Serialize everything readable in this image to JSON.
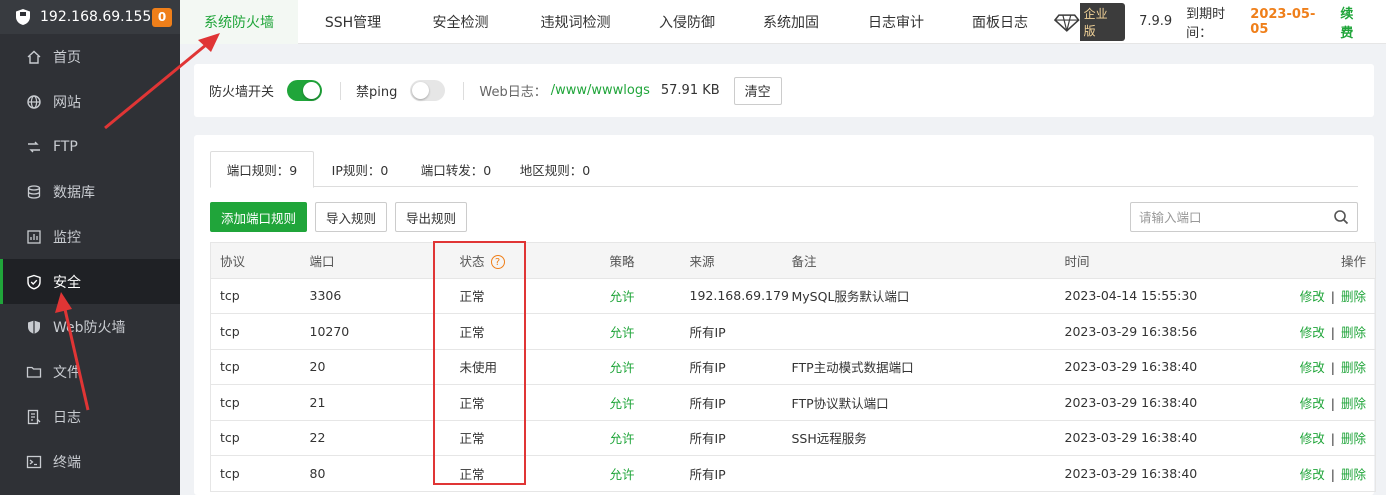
{
  "sidebar": {
    "ip": "192.168.69.155",
    "badge": "0",
    "items": [
      {
        "label": "首页",
        "icon": "home-icon"
      },
      {
        "label": "网站",
        "icon": "globe-icon"
      },
      {
        "label": "FTP",
        "icon": "ftp-icon"
      },
      {
        "label": "数据库",
        "icon": "database-icon"
      },
      {
        "label": "监控",
        "icon": "monitor-icon"
      },
      {
        "label": "安全",
        "icon": "shield-check-icon"
      },
      {
        "label": "Web防火墙",
        "icon": "shield-icon"
      },
      {
        "label": "文件",
        "icon": "folder-icon"
      },
      {
        "label": "日志",
        "icon": "log-icon"
      },
      {
        "label": "终端",
        "icon": "terminal-icon"
      }
    ],
    "active_index": 5
  },
  "topbar": {
    "tabs": [
      "系统防火墙",
      "SSH管理",
      "安全检测",
      "违规词检测",
      "入侵防御",
      "系统加固",
      "日志审计",
      "面板日志"
    ],
    "active_index": 0,
    "edition": "企业版",
    "version": "7.9.9",
    "expire_label": "到期时间：",
    "expire_date": "2023-05-05",
    "renew": "续费"
  },
  "firewall": {
    "switch_label": "防火墙开关",
    "switch_on": true,
    "ping_label": "禁ping",
    "ping_on": false,
    "weblog_label": "Web日志：",
    "weblog_path": "/www/wwwlogs",
    "weblog_size": "57.91 KB",
    "clear_label": "清空"
  },
  "subtabs": [
    "端口规则：9",
    "IP规则：0",
    "端口转发：0",
    "地区规则：0"
  ],
  "toolbar": {
    "add_label": "添加端口规则",
    "import_label": "导入规则",
    "export_label": "导出规则",
    "search_placeholder": "请输入端口"
  },
  "table": {
    "headers": [
      "协议",
      "端口",
      "状态",
      "策略",
      "来源",
      "备注",
      "时间",
      "操作"
    ],
    "rows": [
      {
        "protocol": "tcp",
        "port": "3306",
        "status": "正常",
        "policy": "允许",
        "source": "192.168.69.179",
        "remark": "MySQL服务默认端口",
        "time": "2023-04-14 15:55:30"
      },
      {
        "protocol": "tcp",
        "port": "10270",
        "status": "正常",
        "policy": "允许",
        "source": "所有IP",
        "remark": "",
        "time": "2023-03-29 16:38:56"
      },
      {
        "protocol": "tcp",
        "port": "20",
        "status": "未使用",
        "policy": "允许",
        "source": "所有IP",
        "remark": "FTP主动模式数据端口",
        "time": "2023-03-29 16:38:40"
      },
      {
        "protocol": "tcp",
        "port": "21",
        "status": "正常",
        "policy": "允许",
        "source": "所有IP",
        "remark": "FTP协议默认端口",
        "time": "2023-03-29 16:38:40"
      },
      {
        "protocol": "tcp",
        "port": "22",
        "status": "正常",
        "policy": "允许",
        "source": "所有IP",
        "remark": "SSH远程服务",
        "time": "2023-03-29 16:38:40"
      },
      {
        "protocol": "tcp",
        "port": "80",
        "status": "正常",
        "policy": "允许",
        "source": "所有IP",
        "remark": "",
        "time": "2023-03-29 16:38:40"
      }
    ],
    "op_edit": "修改",
    "op_separator": "|",
    "op_delete": "删除"
  },
  "colors": {
    "brand_green": "#20a53a",
    "accent_orange": "#ef7f1a",
    "annotation_red": "#e03535",
    "sidebar_bg": "#2f3136"
  }
}
